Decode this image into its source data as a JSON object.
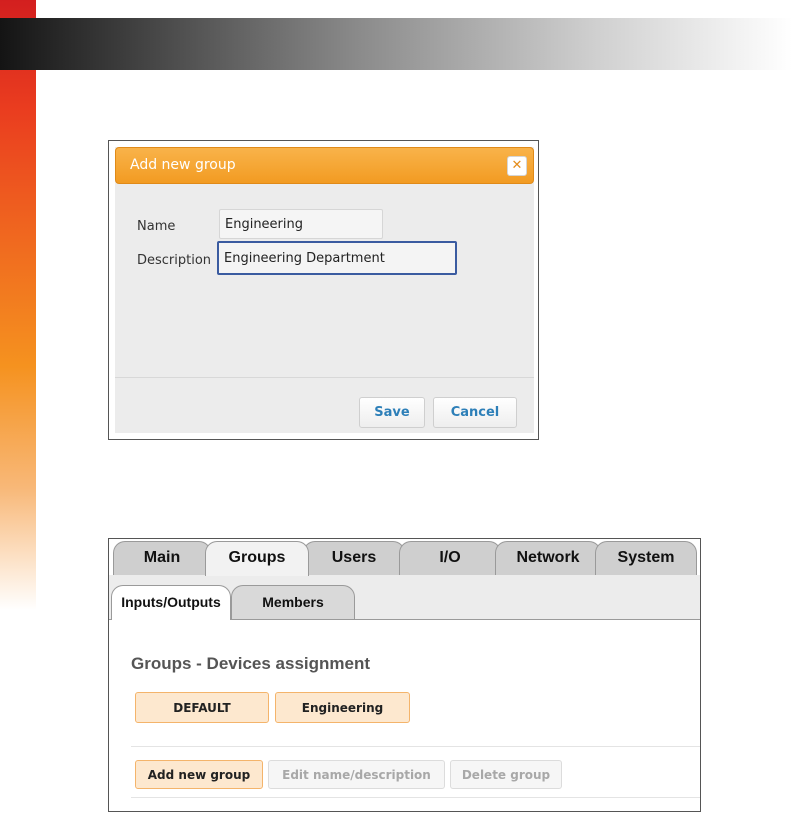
{
  "dialog": {
    "title": "Add new group",
    "close_icon": "close-icon",
    "fields": {
      "name": {
        "label": "Name",
        "value": "Engineering"
      },
      "description": {
        "label": "Description",
        "value": "Engineering Department"
      }
    },
    "buttons": {
      "save": "Save",
      "cancel": "Cancel"
    }
  },
  "panel": {
    "tabs": [
      "Main",
      "Groups",
      "Users",
      "I/O",
      "Network",
      "System"
    ],
    "active_tab": "Groups",
    "subtabs": [
      "Inputs/Outputs",
      "Members"
    ],
    "active_subtab": "Inputs/Outputs",
    "section_title": "Groups - Devices assignment",
    "groups": [
      "DEFAULT",
      "Engineering"
    ],
    "actions": {
      "add": "Add new group",
      "edit": "Edit name/description",
      "delete": "Delete group"
    }
  },
  "colors": {
    "dialog_header": "#f29b22",
    "action_text": "#2d7fb8",
    "focus_border": "#3a5ba0",
    "group_button_bg": "#fde8cf"
  }
}
